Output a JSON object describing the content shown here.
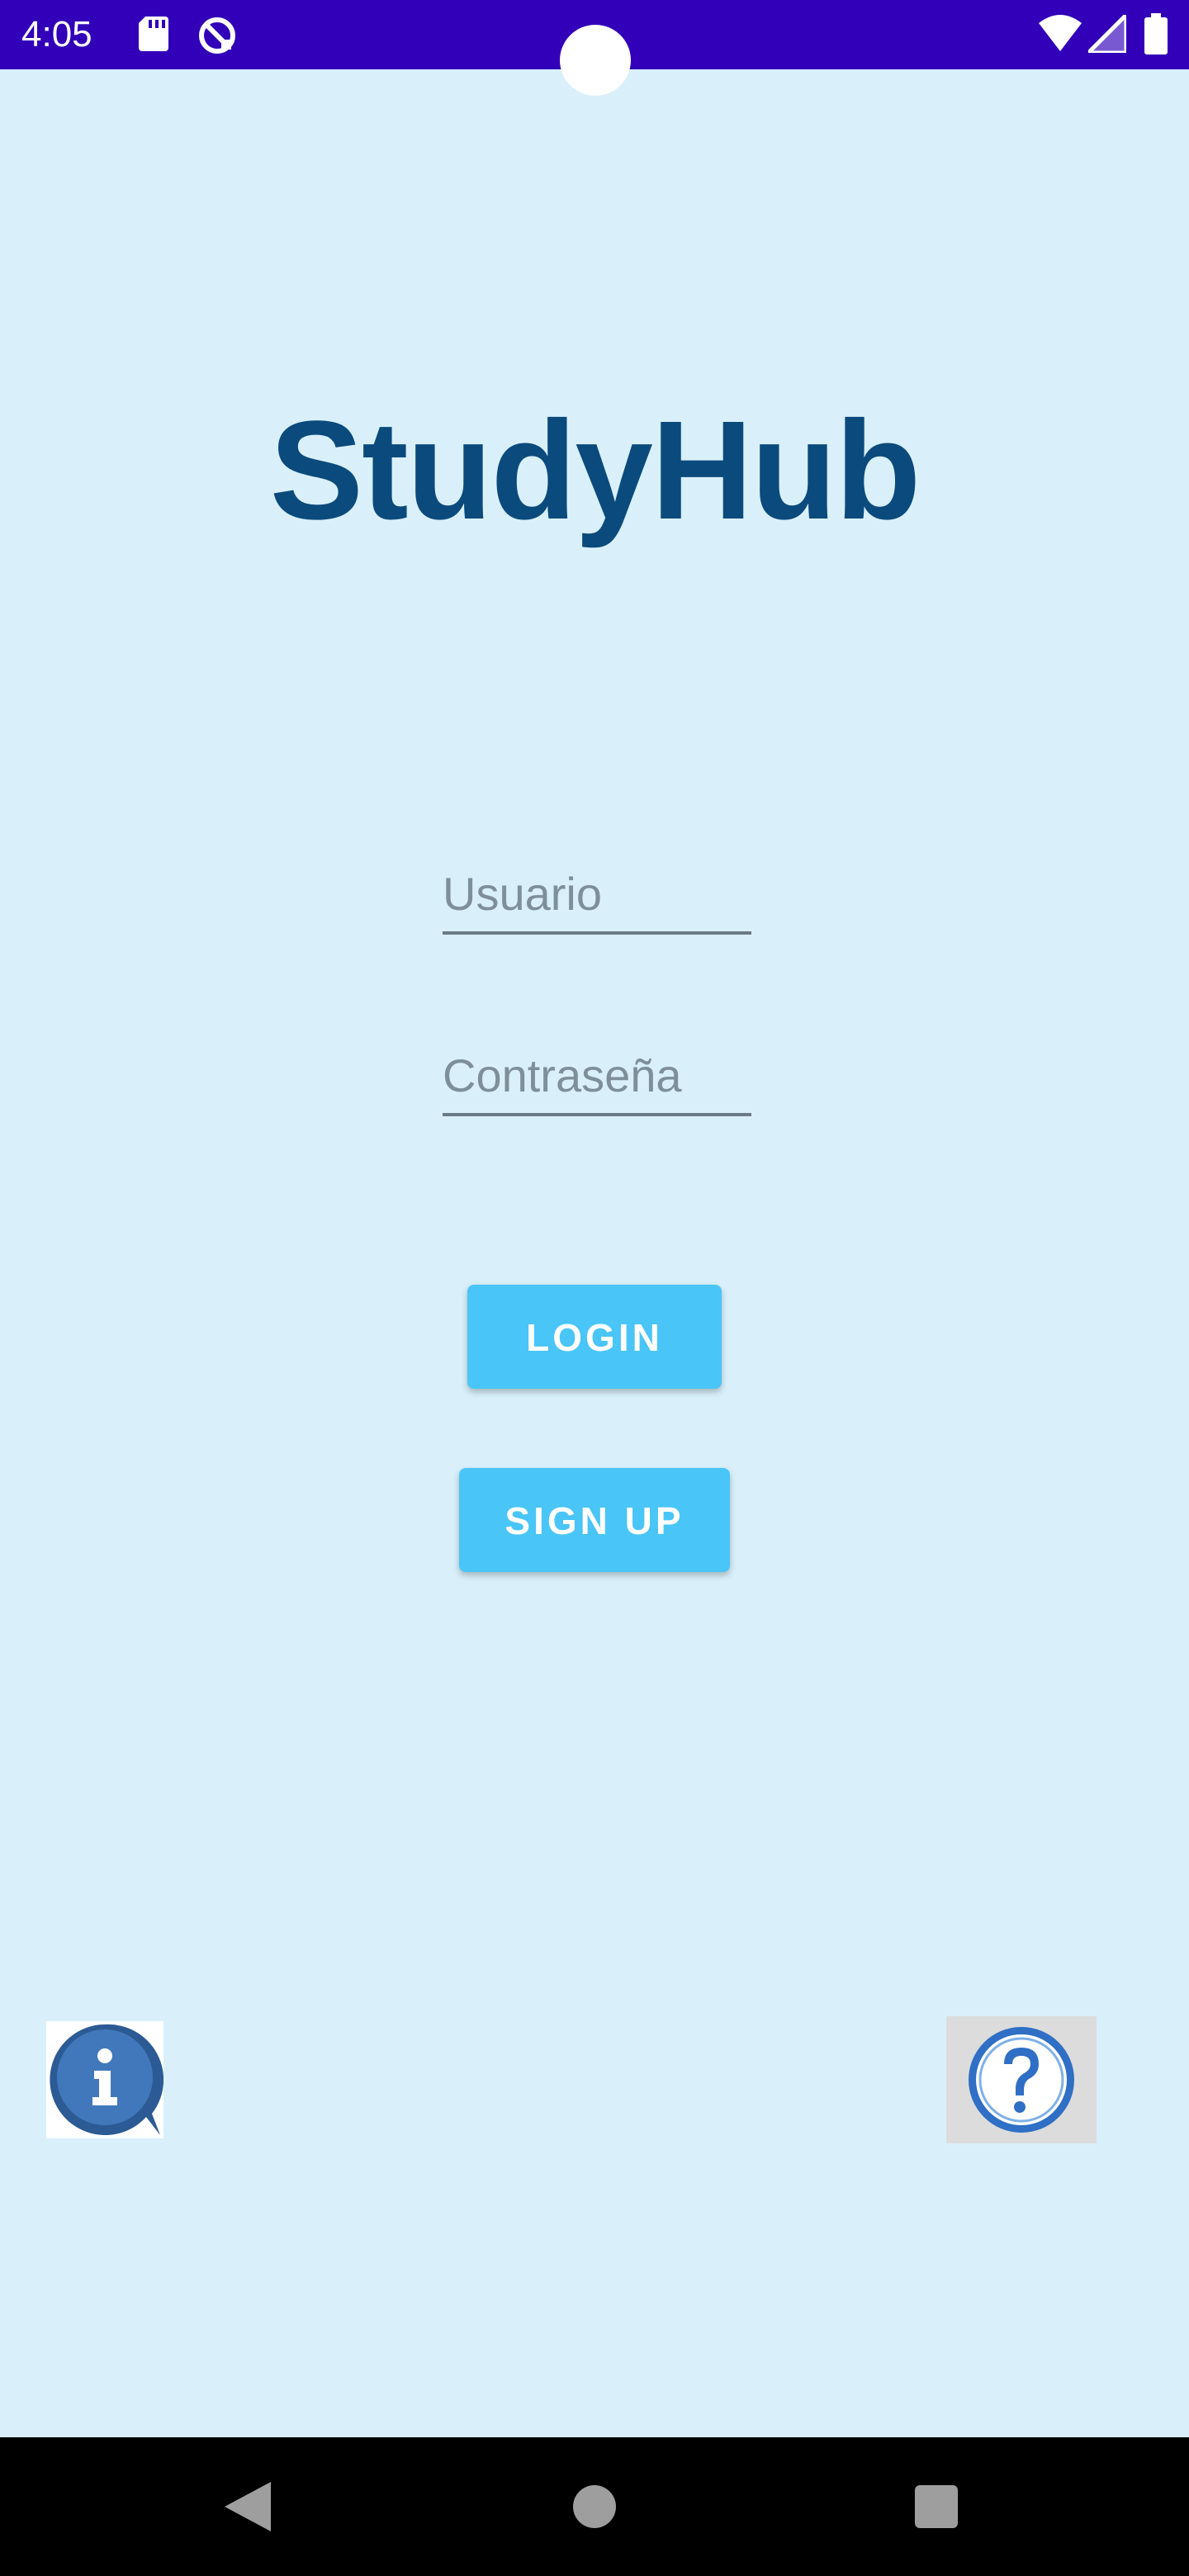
{
  "status_bar": {
    "time": "4:05",
    "icons": [
      "sd-card-icon",
      "sync-icon",
      "wifi-icon",
      "signal-icon",
      "battery-icon"
    ]
  },
  "app": {
    "title": "StudyHub"
  },
  "form": {
    "username_placeholder": "Usuario",
    "password_placeholder": "Contraseña",
    "username_value": "",
    "password_value": ""
  },
  "buttons": {
    "login_label": "LOGIN",
    "signup_label": "SIGN UP"
  },
  "bottom_icons": {
    "info": "info-icon",
    "help": "help-icon"
  },
  "nav_bar": {
    "icons": [
      "back-icon",
      "home-icon",
      "recents-icon"
    ]
  },
  "colors": {
    "status_bar": "#3100b8",
    "background": "#d9f0fa",
    "title": "#0b4a7c",
    "button": "#49c5f7"
  }
}
